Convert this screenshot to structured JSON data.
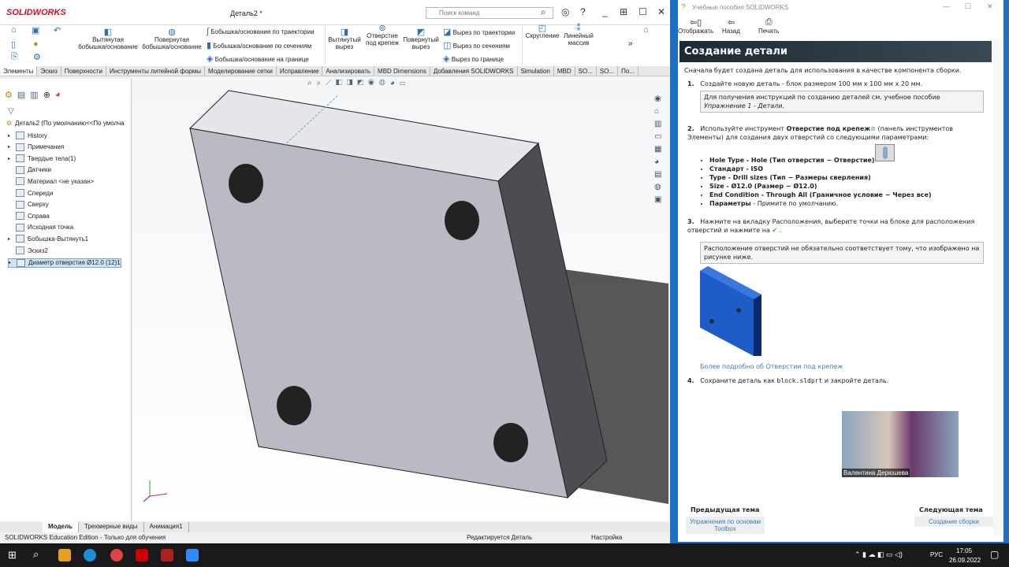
{
  "app": {
    "logo": "SOLIDWORKS",
    "doc_title": "Деталь2 *",
    "search_placeholder": "Поиск команд"
  },
  "ribbon": {
    "extrude_boss": "Вытянутая бобышка/основание",
    "revolve_boss": "Повернутая бобышка/основание",
    "sweep_boss": "Бобышка/основание по траектории",
    "loft_boss": "Бобышка/основание по сечениям",
    "boundary_boss": "Бобышка/основание на границе",
    "extrude_cut": "Вытянутый вырез",
    "hole_wizard": "Отверстие под крепеж",
    "revolve_cut": "Повернутый вырез",
    "sweep_cut": "Вырез по траектории",
    "loft_cut": "Вырез по сечениям",
    "boundary_cut": "Вырез по границе",
    "fillet": "Скругление",
    "linear_pattern": "Линейный массив"
  },
  "command_tabs": [
    "Элементы",
    "Эскиз",
    "Поверхности",
    "Инструменты литейной формы",
    "Моделирование сетки",
    "Исправление",
    "Анализировать",
    "MBD Dimensions",
    "Добавления SOLIDWORKS",
    "Simulation",
    "MBD",
    "SO...",
    "SO...",
    "По..."
  ],
  "tree": {
    "root": "Деталь2  (По умолчанию<<По умолча",
    "items": [
      "History",
      "Примечания",
      "Твердые тела(1)",
      "Датчики",
      "Материал <не указан>",
      "Спереди",
      "Сверху",
      "Справа",
      "Исходная точка",
      "Бобышка-Вытянуть1",
      "Эскиз2",
      "Диаметр отверстия Ø12.0 (12)1"
    ]
  },
  "bottom_tabs": [
    "Модель",
    "Трехмерные виды",
    "Анимация1"
  ],
  "status": {
    "edition": "SOLIDWORKS Education Edition - Только для обучения",
    "editing": "Редактируется Деталь",
    "settings": "Настройка"
  },
  "tutorial": {
    "window_title": "Учебные пособия SOLIDWORKS",
    "toolbar": [
      "Отображать",
      "Назад",
      "Печать"
    ],
    "heading": "Создание детали",
    "intro": "Сначала будет создана деталь для использования в качестве компонента сборки.",
    "step1": "Создайте новую деталь - блок размером 100 мм x 100 мм x 20 мм.",
    "note1a": "Для получения инструкций по созданию деталей см. учебное пособие",
    "note1b": "Упражнение 1 - Детали.",
    "step2a": "Используйте инструмент ",
    "step2b": "Отверстие под крепеж",
    "step2c": " (панель инструментов Элементы) для создания двух отверстий со следующими параметрами:",
    "bullets": [
      "Hole Type - Hole (Тип отверстия − Отверстие)",
      "Стандарт - ISO",
      "Type - Drill sizes (Тип − Размеры сверления)",
      "Size - Ø12.0 (Размер − Ø12.0)",
      "End Condition - Through All (Граничное условие − Через все)"
    ],
    "bullet_last_b": "Параметры",
    "bullet_last": " - Примите по умолчанию.",
    "step3": "Нажмите на вкладку Расположения, выберите точки на блоке для расположения отверстий и нажмите на",
    "note3": "Расположение отверстий не обязательно соответствует тому, что изображено на рисунке ниже.",
    "more_link": "Более подробно об Отверстии под крепеж",
    "step4a": "Сохраните деталь как ",
    "step4code": "block.sldprt",
    "step4b": " и закройте деталь.",
    "webcam_name": "Валентина Дерюшева",
    "prev_label": "Предыдущая тема",
    "prev_link": "Упражнения по основам Toolbox",
    "next_label": "Следующая тема",
    "next_link": "Создание сборки"
  },
  "taskbar": {
    "lang": "РУС",
    "time": "17:05",
    "date": "26.09.2022"
  }
}
